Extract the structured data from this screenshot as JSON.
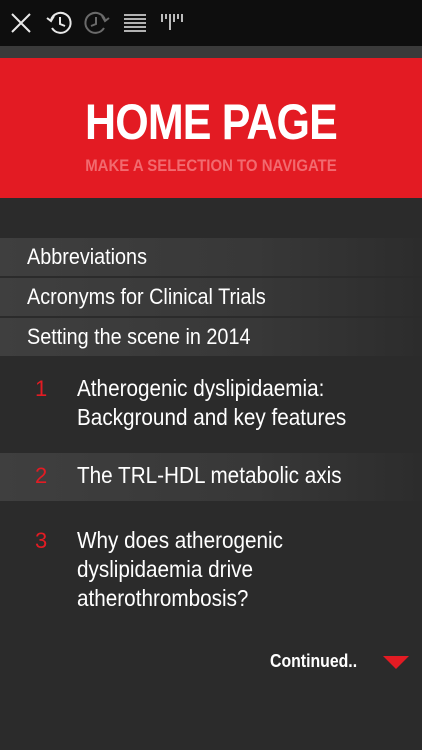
{
  "header": {
    "title": "HOME PAGE",
    "subtitle": "MAKE A SELECTION TO NAVIGATE"
  },
  "menu": {
    "items": [
      {
        "label": "Abbreviations"
      },
      {
        "label": "Acronyms for Clinical Trials"
      },
      {
        "label": "Setting the scene in 2014"
      }
    ]
  },
  "chapters": [
    {
      "number": "1",
      "title": "Atherogenic dyslipidaemia:\nBackground and key features"
    },
    {
      "number": "2",
      "title": "The TRL-HDL metabolic axis"
    },
    {
      "number": "3",
      "title": "Why does atherogenic\ndyslipidaemia drive\natherothrombosis?"
    }
  ],
  "footer": {
    "continued_label": "Continued.."
  },
  "colors": {
    "accent": "#e31b23",
    "background": "#2b2b2b",
    "toolbar": "#0e0e0e"
  },
  "icons": [
    "close-icon",
    "history-icon",
    "forward-icon",
    "list-icon",
    "bookmark-icon",
    "chevron-down-icon"
  ]
}
